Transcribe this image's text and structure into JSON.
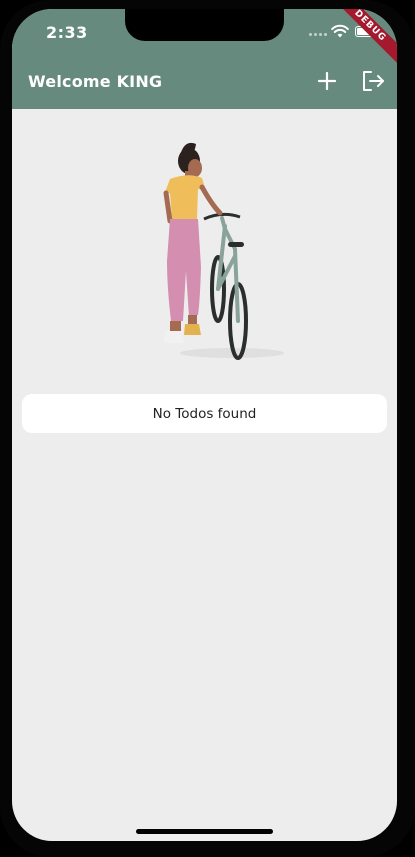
{
  "status_bar": {
    "time": "2:33",
    "icons": [
      "cellular-signal-icon",
      "wifi-icon",
      "battery-icon"
    ]
  },
  "debug_banner": "DEBUG",
  "app_bar": {
    "title": "Welcome KING",
    "background": "#678a7e",
    "actions": [
      {
        "icon": "plus-icon",
        "label": "+"
      },
      {
        "icon": "logout-icon"
      }
    ]
  },
  "body": {
    "background": "#ededed",
    "illustration": "woman-with-bicycle-illustration",
    "empty_message": "No Todos found"
  }
}
